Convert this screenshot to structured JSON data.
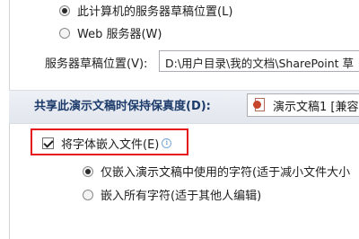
{
  "publish_location": {
    "option_local": "此计算机的服务器草稿位置(L)",
    "option_web": "Web 服务器(W)",
    "drafts_location_label": "服务器草稿位置(V):",
    "drafts_location_value": "D:\\用户目录\\我的文档\\SharePoint 草"
  },
  "fidelity": {
    "section_title": "共享此演示文稿时保持保真度(D):",
    "document_select": "演示文稿1 [兼容",
    "embed_fonts_label": "将字体嵌入文件(E)",
    "embed_fonts_checked": true,
    "embed_used_only": "仅嵌入演示文稿中使用的字符(适于减小文件大小",
    "embed_all": "嵌入所有字符(适于其他人编辑)"
  },
  "colors": {
    "highlight": "#e6171c",
    "section_title": "#1c3b6b"
  },
  "icons": {
    "info": "info-icon",
    "document": "powerpoint-file-icon"
  }
}
